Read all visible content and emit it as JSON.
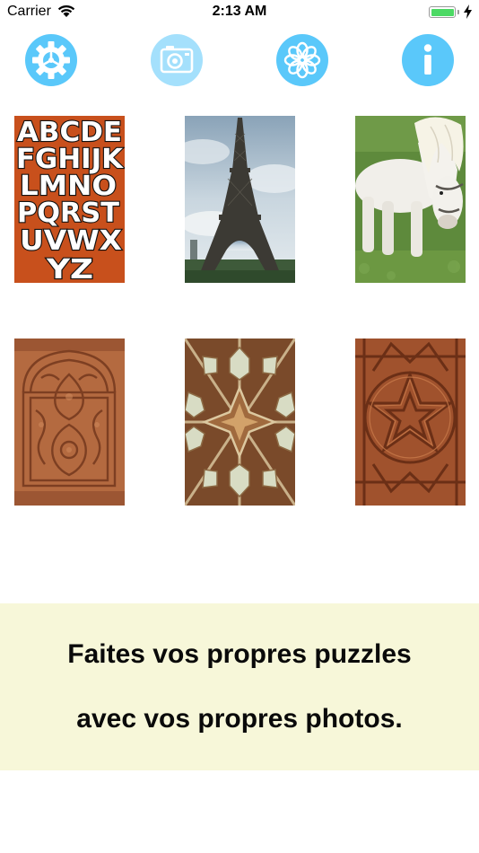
{
  "status_bar": {
    "carrier": "Carrier",
    "time": "2:13 AM",
    "battery_level": 1.0,
    "battery_color": "#4cd964"
  },
  "toolbar": {
    "accent_color": "#5ac8fa",
    "buttons": [
      {
        "icon": "gear-icon",
        "enabled": true
      },
      {
        "icon": "camera-icon",
        "enabled": false
      },
      {
        "icon": "flower-icon",
        "enabled": true
      },
      {
        "icon": "info-icon",
        "enabled": true
      }
    ]
  },
  "puzzles": [
    {
      "subject": "alphabet",
      "letters": [
        "ABCDE",
        "FGHIJK",
        "LMNO",
        "PQRST",
        "UVWX",
        "YZ"
      ]
    },
    {
      "subject": "eiffel-tower"
    },
    {
      "subject": "white-pony"
    },
    {
      "subject": "carved-wood-panel"
    },
    {
      "subject": "geometric-wood-tiles"
    },
    {
      "subject": "carved-star-pattern"
    }
  ],
  "banner": {
    "line1": "Faites vos propres puzzles",
    "line2": "avec vos propres photos.",
    "background": "#f7f7d9"
  }
}
